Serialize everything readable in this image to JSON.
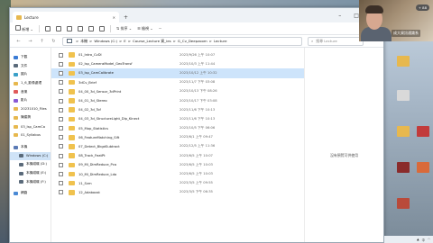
{
  "window": {
    "tab_title": "Lecture",
    "new_tab": "+",
    "controls": [
      "–",
      "□",
      "✕"
    ]
  },
  "cmdbar": {
    "new_label": "新增",
    "sort_label": "排序",
    "view_label": "檢視"
  },
  "address": {
    "segments": [
      "本機",
      "Windows (C:)",
      "E",
      "Course_Lecture 資_ies",
      "G_Cv_Deepzoom",
      "Lecture"
    ],
    "separator": ">"
  },
  "search": {
    "placeholder": "搜尋 Lecture"
  },
  "sidebar": {
    "items": [
      {
        "label": "下載",
        "color": "#3a7bd5"
      },
      {
        "label": "文件",
        "color": "#5a6a7a"
      },
      {
        "label": "圖片",
        "color": "#3aa0c8"
      },
      {
        "label": "1_6_影像處理",
        "color": "#e7b84e"
      },
      {
        "label": "音樂",
        "color": "#e05a5a"
      },
      {
        "label": "影片",
        "color": "#8a5ad5"
      },
      {
        "label": "20231010_Files",
        "color": "#e7b84e"
      },
      {
        "label": "陳建興",
        "color": "#e7b84e"
      },
      {
        "label": "03_Isp_CamCa",
        "color": "#e7b84e"
      },
      {
        "label": "01_Syllabus",
        "color": "#e7b84e"
      },
      {
        "label": "本機",
        "color": "#5a7ab5"
      },
      {
        "label": "Windows (C:)",
        "color": "#5a6a7a"
      },
      {
        "label": "本機磁碟 (D:)",
        "color": "#5a6a7a"
      },
      {
        "label": "本機磁碟 (E:)",
        "color": "#5a6a7a"
      },
      {
        "label": "本機磁碟 (F:)",
        "color": "#5a6a7a"
      },
      {
        "label": "網路",
        "color": "#4a8ad5"
      }
    ]
  },
  "files": [
    {
      "name": "01_Intro_CvDl",
      "date": "2023/9/26 上午 10:07"
    },
    {
      "name": "02_Isp_CameraModel_GeoTransf",
      "date": "2023/10/3 上午 11:44"
    },
    {
      "name": "03_Isp_CamCalibrate",
      "date": "2023/10/12 上午 10:32"
    },
    {
      "name": "3dCv_Brief",
      "date": "2023/11/7 下午 03:08"
    },
    {
      "name": "04_00_3d_Sensor_3dPrint",
      "date": "2023/10/13 下午 08:26"
    },
    {
      "name": "04_01_3d_Stereo",
      "date": "2023/10/17 下午 03:08"
    },
    {
      "name": "04_02_3d_Tof",
      "date": "2023/11/6 下午 10:13"
    },
    {
      "name": "04_03_3d_StructureLight_Dlp_Kinect",
      "date": "2023/11/6 下午 10:13"
    },
    {
      "name": "05_Mop_Statistics",
      "date": "2023/10/5 下午 06:06"
    },
    {
      "name": "06_FeatureMatching_Sift",
      "date": "2023/6/1 上午 09:47"
    },
    {
      "name": "07_Detect_BkgdSubtract",
      "date": "2022/12/5 上午 11:36"
    },
    {
      "name": "08_Track_FeatPt",
      "date": "2023/6/5 上午 10:07"
    },
    {
      "name": "09_Ml_DimReduce_Pca",
      "date": "2023/6/5 上午 10:03"
    },
    {
      "name": "10_Ml_DimReduce_Lda",
      "date": "2023/6/5 上午 10:03"
    },
    {
      "name": "11_Svm",
      "date": "2023/3/5 上午 09:55"
    },
    {
      "name": "12_Adaboost",
      "date": "2023/3/5 下午 06:35"
    }
  ],
  "selected_index": 2,
  "details_pane": {
    "message": "沒有預覽可供使用"
  },
  "webcam": {
    "caption": "成大資訊通識系",
    "badge": "+ 88"
  }
}
